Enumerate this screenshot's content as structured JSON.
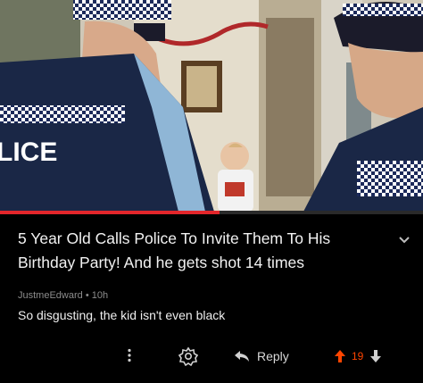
{
  "post": {
    "title": "5 Year Old Calls Police To Invite Them To His Birthday Party! And he gets shot 14 times",
    "video_progress_fraction": 0.52,
    "vest_text": "LICE"
  },
  "comment": {
    "author": "JustmeEdward",
    "separator": "•",
    "age": "10h",
    "body": "So disgusting, the kid isn't even black"
  },
  "actions": {
    "reply_label": "Reply",
    "score": "19"
  },
  "colors": {
    "background": "#000000",
    "progress": "#e3262b",
    "upvote": "#ff4500"
  }
}
